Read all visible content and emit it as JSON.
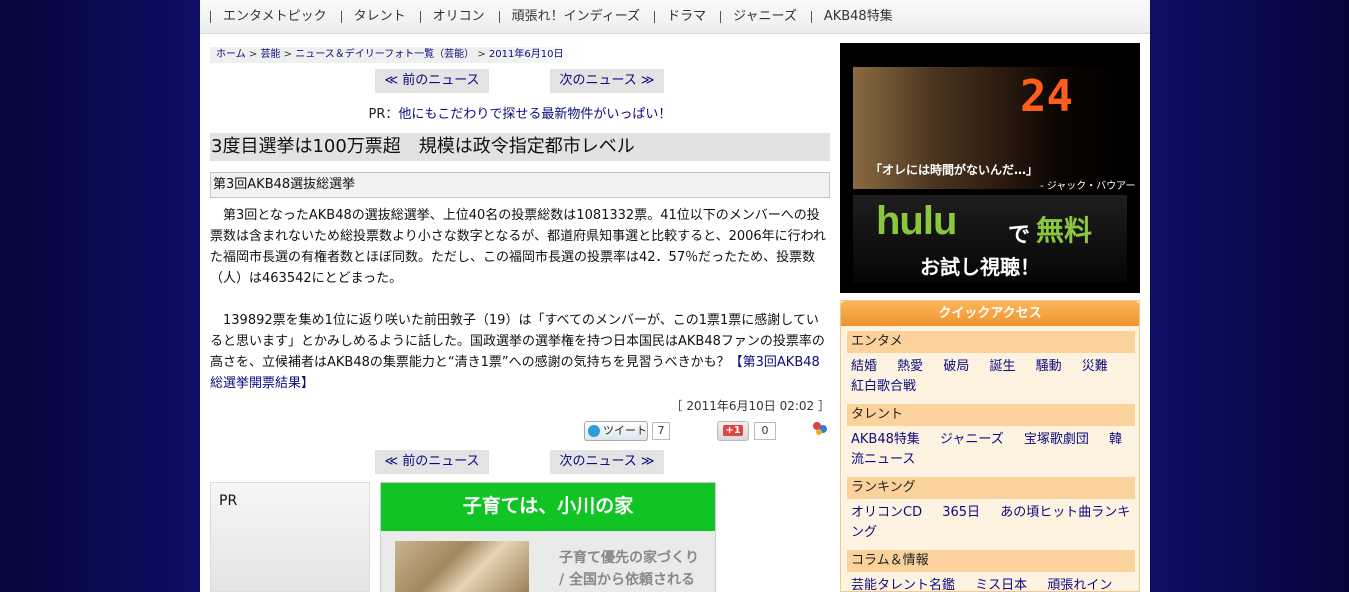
{
  "topnav": {
    "items": [
      "エンタメトピック",
      "タレント",
      "オリコン",
      "頑張れ！インディーズ",
      "ドラマ",
      "ジャニーズ",
      "AKB48特集"
    ]
  },
  "breadcrumb": {
    "items": [
      "ホーム",
      "芸能",
      "ニュース＆デイリーフォト一覧（芸能）",
      "2011年6月10日"
    ],
    "separator": ">"
  },
  "article_nav": {
    "prev_label": "≪ 前のニュース",
    "next_label": "次のニュース ≫"
  },
  "pr_top": {
    "label": "PR：",
    "text": "他にもこだわりで探せる最新物件がいっぱい！"
  },
  "article": {
    "headline": "3度目選挙は100万票超　規模は政令指定都市レベル",
    "subhead": "第3回AKB48選抜総選挙",
    "paragraph1": "　第3回となったAKB48の選抜総選挙、上位40名の投票総数は1081332票。41位以下のメンバーへの投票数は含まれないため総投票数より小さな数字となるが、都道府県知事選と比較すると、2006年に行われた福岡市長選の有権者数とほぼ同数。ただし、この福岡市長選の投票率は42．57％だったため、投票数（人）は463542にとどまった。",
    "paragraph2": "　139892票を集め1位に返り咲いた前田敦子（19）は「すべてのメンバーが、この1票1票に感謝していると思います」とかみしめるように話した。国政選挙の選挙権を持つ日本国民はAKB48ファンの投票率の高さを、立候補者はAKB48の集票能力と“清き1票”への感謝の気持ちを見習うべきかも？",
    "link_text": "【第3回AKB48総選挙開票結果】",
    "date": "［ 2011年6月10日 02:02 ］"
  },
  "social": {
    "tweet_label": "ツイート",
    "tweet_count": "7",
    "plus_label": "+1",
    "plus_count": "0"
  },
  "pr_left": {
    "label": "PR"
  },
  "ad": {
    "headline": "子育ては、小川の家",
    "text": "子育て優先の家づくり / 全国から依頼される注目の"
  },
  "banner": {
    "number": "24",
    "quote": "「オレには時間がないんだ…」",
    "attribution": "- ジャック・バウアー",
    "brand": "hulu",
    "de": "で",
    "free": "無料",
    "trial": "お試し視聴！"
  },
  "quick_access": {
    "title": "クイックアクセス",
    "sections": [
      {
        "label": "エンタメ",
        "links": [
          "結婚",
          "熱愛",
          "破局",
          "誕生",
          "騒動",
          "災難",
          "紅白歌合戦"
        ]
      },
      {
        "label": "タレント",
        "links": [
          "AKB48特集",
          "ジャニーズ",
          "宝塚歌劇団",
          "韓流ニュース"
        ]
      },
      {
        "label": "ランキング",
        "links": [
          "オリコンCD",
          "365日",
          "あの頃ヒット曲ランキング"
        ]
      },
      {
        "label": "コラム＆情報",
        "links": [
          "芸能タレント名鑑",
          "ミス日本",
          "頑張れイン"
        ]
      }
    ]
  },
  "colors": {
    "background": "#0b0b52",
    "link": "#0b0b80",
    "ad_green": "#10c423",
    "qa_orange": "#ee9430"
  }
}
